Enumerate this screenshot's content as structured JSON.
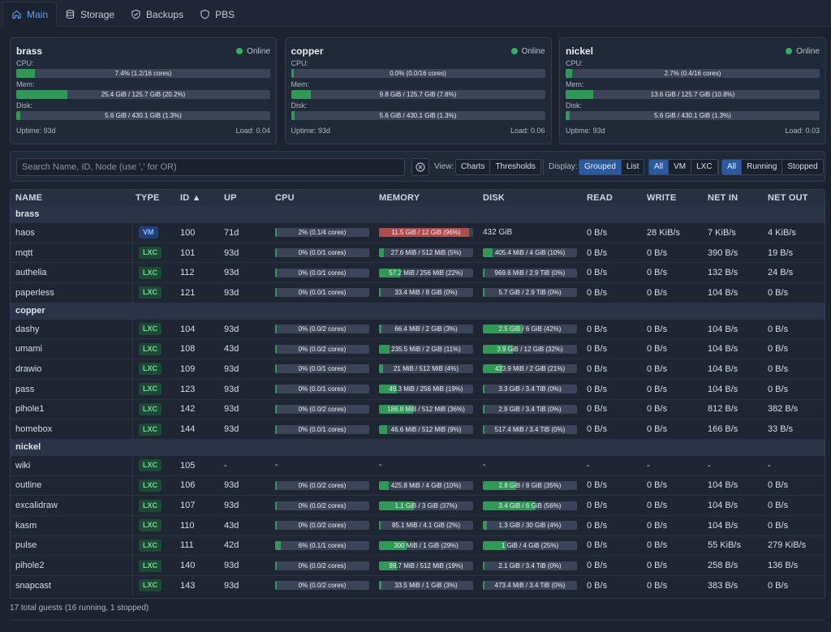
{
  "tabs": [
    {
      "label": "Main",
      "icon": "home-icon",
      "active": true
    },
    {
      "label": "Storage",
      "icon": "database-icon",
      "active": false
    },
    {
      "label": "Backups",
      "icon": "shield-check-icon",
      "active": false
    },
    {
      "label": "PBS",
      "icon": "shield-icon",
      "active": false
    }
  ],
  "nodes": [
    {
      "name": "brass",
      "status": "Online",
      "cpu_label": "CPU:",
      "cpu_text": "7.4% (1.2/16 cores)",
      "cpu_pct": 7.4,
      "mem_label": "Mem:",
      "mem_text": "25.4 GiB / 125.7 GiB (20.2%)",
      "mem_pct": 20.2,
      "disk_label": "Disk:",
      "disk_text": "5.6 GiB / 430.1 GiB (1.3%)",
      "disk_pct": 1.3,
      "uptime": "Uptime: 93d",
      "load": "Load: 0.04"
    },
    {
      "name": "copper",
      "status": "Online",
      "cpu_label": "CPU:",
      "cpu_text": "0.0% (0.0/16 cores)",
      "cpu_pct": 0,
      "mem_label": "Mem:",
      "mem_text": "9.8 GiB / 125.7 GiB (7.8%)",
      "mem_pct": 7.8,
      "disk_label": "Disk:",
      "disk_text": "5.6 GiB / 430.1 GiB (1.3%)",
      "disk_pct": 1.3,
      "uptime": "Uptime: 93d",
      "load": "Load: 0.06"
    },
    {
      "name": "nickel",
      "status": "Online",
      "cpu_label": "CPU:",
      "cpu_text": "2.7% (0.4/16 cores)",
      "cpu_pct": 2.7,
      "mem_label": "Mem:",
      "mem_text": "13.6 GiB / 125.7 GiB (10.8%)",
      "mem_pct": 10.8,
      "disk_label": "Disk:",
      "disk_text": "5.6 GiB / 430.1 GiB (1.3%)",
      "disk_pct": 1.3,
      "uptime": "Uptime: 93d",
      "load": "Load: 0.03"
    }
  ],
  "filters": {
    "search_placeholder": "Search Name, ID, Node (use ',' for OR)",
    "view_label": "View:",
    "view_options": [
      "Charts",
      "Thresholds"
    ],
    "display_label": "Display:",
    "display_options": [
      {
        "label": "Grouped",
        "on": true
      },
      {
        "label": "List",
        "on": false
      }
    ],
    "type_options": [
      {
        "label": "All",
        "on": true
      },
      {
        "label": "VM",
        "on": false
      },
      {
        "label": "LXC",
        "on": false
      }
    ],
    "status_options": [
      {
        "label": "All",
        "on": true
      },
      {
        "label": "Running",
        "on": false
      },
      {
        "label": "Stopped",
        "on": false
      }
    ]
  },
  "table": {
    "headers": {
      "name": "NAME",
      "type": "TYPE",
      "id": "ID ▲",
      "up": "UP",
      "cpu": "CPU",
      "memory": "MEMORY",
      "disk": "DISK",
      "read": "READ",
      "write": "WRITE",
      "netin": "NET IN",
      "netout": "NET OUT"
    },
    "groups": [
      {
        "node": "brass",
        "rows": [
          {
            "name": "haos",
            "type": "VM",
            "id": "100",
            "up": "71d",
            "cpu": "2% (0.1/4 cores)",
            "cpu_pct": 2,
            "mem": "11.5 GiB / 12 GiB (96%)",
            "mem_pct": 96,
            "mem_alert": true,
            "disk": "432 GiB",
            "disk_plain": true,
            "read": "0 B/s",
            "write": "28 KiB/s",
            "netin": "7 KiB/s",
            "netout": "4 KiB/s"
          },
          {
            "name": "mqtt",
            "type": "LXC",
            "id": "101",
            "up": "93d",
            "cpu": "0% (0.0/1 cores)",
            "cpu_pct": 0,
            "mem": "27.6 MiB / 512 MiB (5%)",
            "mem_pct": 5,
            "disk": "405.4 MiB / 4 GiB (10%)",
            "disk_pct": 10,
            "read": "0 B/s",
            "write": "0 B/s",
            "netin": "390 B/s",
            "netout": "19 B/s"
          },
          {
            "name": "authelia",
            "type": "LXC",
            "id": "112",
            "up": "93d",
            "cpu": "0% (0.0/1 cores)",
            "cpu_pct": 0,
            "mem": "57.2 MiB / 256 MiB (22%)",
            "mem_pct": 22,
            "disk": "969.6 MiB / 2.9 TiB (0%)",
            "disk_pct": 0,
            "read": "0 B/s",
            "write": "0 B/s",
            "netin": "132 B/s",
            "netout": "24 B/s"
          },
          {
            "name": "paperless",
            "type": "LXC",
            "id": "121",
            "up": "93d",
            "cpu": "0% (0.0/1 cores)",
            "cpu_pct": 0,
            "mem": "33.4 MiB / 8 GiB (0%)",
            "mem_pct": 0,
            "disk": "5.7 GiB / 2.9 TiB (0%)",
            "disk_pct": 0,
            "read": "0 B/s",
            "write": "0 B/s",
            "netin": "104 B/s",
            "netout": "0 B/s"
          }
        ]
      },
      {
        "node": "copper",
        "rows": [
          {
            "name": "dashy",
            "type": "LXC",
            "id": "104",
            "up": "93d",
            "cpu": "0% (0.0/2 cores)",
            "cpu_pct": 0,
            "mem": "66.4 MiB / 2 GiB (3%)",
            "mem_pct": 3,
            "disk": "2.5 GiB / 6 GiB (42%)",
            "disk_pct": 42,
            "read": "0 B/s",
            "write": "0 B/s",
            "netin": "104 B/s",
            "netout": "0 B/s"
          },
          {
            "name": "umami",
            "type": "LXC",
            "id": "108",
            "up": "43d",
            "cpu": "0% (0.0/2 cores)",
            "cpu_pct": 0,
            "mem": "235.5 MiB / 2 GiB (11%)",
            "mem_pct": 11,
            "disk": "3.9 GiB / 12 GiB (32%)",
            "disk_pct": 32,
            "read": "0 B/s",
            "write": "0 B/s",
            "netin": "104 B/s",
            "netout": "0 B/s"
          },
          {
            "name": "drawio",
            "type": "LXC",
            "id": "109",
            "up": "93d",
            "cpu": "0% (0.0/1 cores)",
            "cpu_pct": 0,
            "mem": "21 MiB / 512 MiB (4%)",
            "mem_pct": 4,
            "disk": "433.9 MiB / 2 GiB (21%)",
            "disk_pct": 21,
            "read": "0 B/s",
            "write": "0 B/s",
            "netin": "104 B/s",
            "netout": "0 B/s"
          },
          {
            "name": "pass",
            "type": "LXC",
            "id": "123",
            "up": "93d",
            "cpu": "0% (0.0/1 cores)",
            "cpu_pct": 0,
            "mem": "49.3 MiB / 256 MiB (19%)",
            "mem_pct": 19,
            "disk": "3.3 GiB / 3.4 TiB (0%)",
            "disk_pct": 0,
            "read": "0 B/s",
            "write": "0 B/s",
            "netin": "104 B/s",
            "netout": "0 B/s"
          },
          {
            "name": "pihole1",
            "type": "LXC",
            "id": "142",
            "up": "93d",
            "cpu": "0% (0.0/2 cores)",
            "cpu_pct": 0,
            "mem": "186.8 MiB / 512 MiB (36%)",
            "mem_pct": 36,
            "disk": "2.9 GiB / 3.4 TiB (0%)",
            "disk_pct": 0,
            "read": "0 B/s",
            "write": "0 B/s",
            "netin": "812 B/s",
            "netout": "382 B/s"
          },
          {
            "name": "homebox",
            "type": "LXC",
            "id": "144",
            "up": "93d",
            "cpu": "0% (0.0/1 cores)",
            "cpu_pct": 0,
            "mem": "46.6 MiB / 512 MiB (9%)",
            "mem_pct": 9,
            "disk": "517.4 MiB / 3.4 TiB (0%)",
            "disk_pct": 0,
            "read": "0 B/s",
            "write": "0 B/s",
            "netin": "166 B/s",
            "netout": "33 B/s"
          }
        ]
      },
      {
        "node": "nickel",
        "rows": [
          {
            "name": "wiki",
            "type": "LXC",
            "id": "105",
            "up": "-",
            "cpu": "-",
            "cpu_plain": true,
            "mem": "-",
            "mem_plain": true,
            "disk": "-",
            "disk_plain": true,
            "read": "-",
            "write": "-",
            "netin": "-",
            "netout": "-"
          },
          {
            "name": "outline",
            "type": "LXC",
            "id": "106",
            "up": "93d",
            "cpu": "0% (0.0/2 cores)",
            "cpu_pct": 0,
            "mem": "425.8 MiB / 4 GiB (10%)",
            "mem_pct": 10,
            "disk": "2.8 GiB / 8 GiB (35%)",
            "disk_pct": 35,
            "read": "0 B/s",
            "write": "0 B/s",
            "netin": "104 B/s",
            "netout": "0 B/s"
          },
          {
            "name": "excalidraw",
            "type": "LXC",
            "id": "107",
            "up": "93d",
            "cpu": "0% (0.0/2 cores)",
            "cpu_pct": 0,
            "mem": "1.1 GiB / 3 GiB (37%)",
            "mem_pct": 37,
            "disk": "3.4 GiB / 6 GiB (56%)",
            "disk_pct": 56,
            "read": "0 B/s",
            "write": "0 B/s",
            "netin": "104 B/s",
            "netout": "0 B/s"
          },
          {
            "name": "kasm",
            "type": "LXC",
            "id": "110",
            "up": "43d",
            "cpu": "0% (0.0/2 cores)",
            "cpu_pct": 0,
            "mem": "85.1 MiB / 4.1 GiB (2%)",
            "mem_pct": 2,
            "disk": "1.3 GiB / 30 GiB (4%)",
            "disk_pct": 4,
            "read": "0 B/s",
            "write": "0 B/s",
            "netin": "104 B/s",
            "netout": "0 B/s"
          },
          {
            "name": "pulse",
            "type": "LXC",
            "id": "111",
            "up": "42d",
            "cpu": "6% (0.1/1 cores)",
            "cpu_pct": 6,
            "mem": "300 MiB / 1 GiB (29%)",
            "mem_pct": 29,
            "disk": "1 GiB / 4 GiB (25%)",
            "disk_pct": 25,
            "read": "0 B/s",
            "write": "0 B/s",
            "netin": "55 KiB/s",
            "netout": "279 KiB/s"
          },
          {
            "name": "pihole2",
            "type": "LXC",
            "id": "140",
            "up": "93d",
            "cpu": "0% (0.0/2 cores)",
            "cpu_pct": 0,
            "mem": "98.7 MiB / 512 MiB (19%)",
            "mem_pct": 19,
            "disk": "2.1 GiB / 3.4 TiB (0%)",
            "disk_pct": 0,
            "read": "0 B/s",
            "write": "0 B/s",
            "netin": "258 B/s",
            "netout": "136 B/s"
          },
          {
            "name": "snapcast",
            "type": "LXC",
            "id": "143",
            "up": "93d",
            "cpu": "0% (0.0/2 cores)",
            "cpu_pct": 0,
            "mem": "33.5 MiB / 1 GiB (3%)",
            "mem_pct": 3,
            "disk": "473.4 MiB / 3.4 TiB (0%)",
            "disk_pct": 0,
            "read": "0 B/s",
            "write": "0 B/s",
            "netin": "383 B/s",
            "netout": "0 B/s"
          }
        ]
      }
    ]
  },
  "footer": "17 total guests (16 running, 1 stopped)",
  "colors": {
    "accent": "#5aa3f0",
    "ok": "#2e9a55",
    "alert": "#b54a4a",
    "online": "#2fb25c"
  }
}
